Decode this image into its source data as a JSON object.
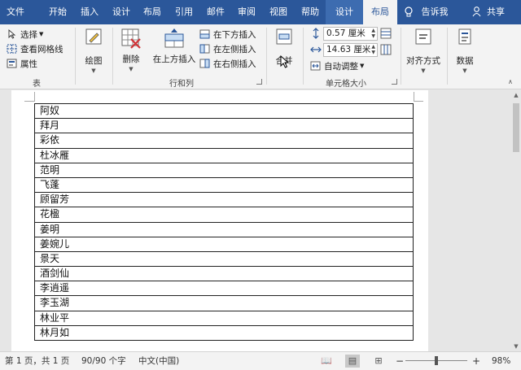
{
  "tabs": [
    {
      "label": "文件"
    },
    {
      "label": "开始"
    },
    {
      "label": "插入"
    },
    {
      "label": "设计"
    },
    {
      "label": "布局"
    },
    {
      "label": "引用"
    },
    {
      "label": "邮件"
    },
    {
      "label": "审阅"
    },
    {
      "label": "视图"
    },
    {
      "label": "帮助"
    },
    {
      "label": "设计"
    },
    {
      "label": "布局"
    }
  ],
  "tell_me": "告诉我",
  "share": "共享",
  "ribbon": {
    "table_group": {
      "label": "表",
      "select": "选择",
      "view_gridlines": "查看网格线",
      "properties": "属性"
    },
    "draw": "绘图",
    "delete": "删除",
    "insert_above": "在上方插入",
    "insert_below": "在下方插入",
    "insert_left": "在左侧插入",
    "insert_right": "在右侧插入",
    "rows_cols_label": "行和列",
    "merge": "合并",
    "cell_size": {
      "label": "单元格大小",
      "height": "0.57 厘米",
      "width": "14.63 厘米",
      "autofit": "自动调整"
    },
    "alignment": "对齐方式",
    "data": "数据"
  },
  "table_rows": [
    "阿奴",
    "拜月",
    "彩依",
    "杜冰雁",
    "范明",
    "飞蓬",
    "顾留芳",
    "花楹",
    "姜明",
    "姜婉儿",
    "景天",
    "酒剑仙",
    "李逍遥",
    "李玉湖",
    "林业平",
    "林月如"
  ],
  "status": {
    "page": "第 1 页，共 1 页",
    "words": "90/90 个字",
    "language": "中文(中国)",
    "zoom": "98%"
  },
  "colors": {
    "title_bar": "#2b579a",
    "ribbon_bg": "#f3f3f3",
    "accent_blue": "#2b579a"
  }
}
